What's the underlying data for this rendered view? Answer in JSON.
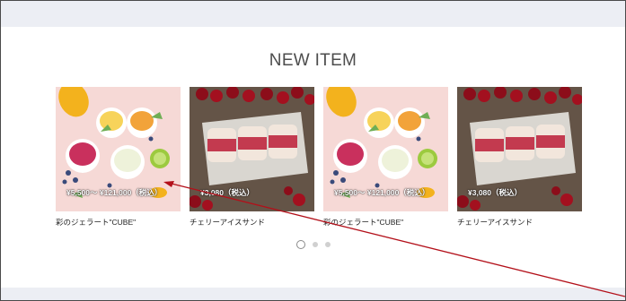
{
  "section": {
    "title": "NEW ITEM"
  },
  "products": [
    {
      "name": "彩のジェラート\"CUBE\"",
      "price": "¥5,500～ ¥121,000（税込）",
      "image": "gelato"
    },
    {
      "name": "チェリーアイスサンド",
      "price": "¥3,080（税込）",
      "image": "cherry"
    },
    {
      "name": "彩のジェラート\"CUBE\"",
      "price": "¥5,500～ ¥121,000（税込）",
      "image": "gelato"
    },
    {
      "name": "チェリーアイスサンド",
      "price": "¥3,080（税込）",
      "image": "cherry"
    }
  ],
  "pagination": {
    "pages": 3,
    "current": 1
  },
  "colors": {
    "band": "#eceef4",
    "annotation_arrow": "#b3101a"
  }
}
